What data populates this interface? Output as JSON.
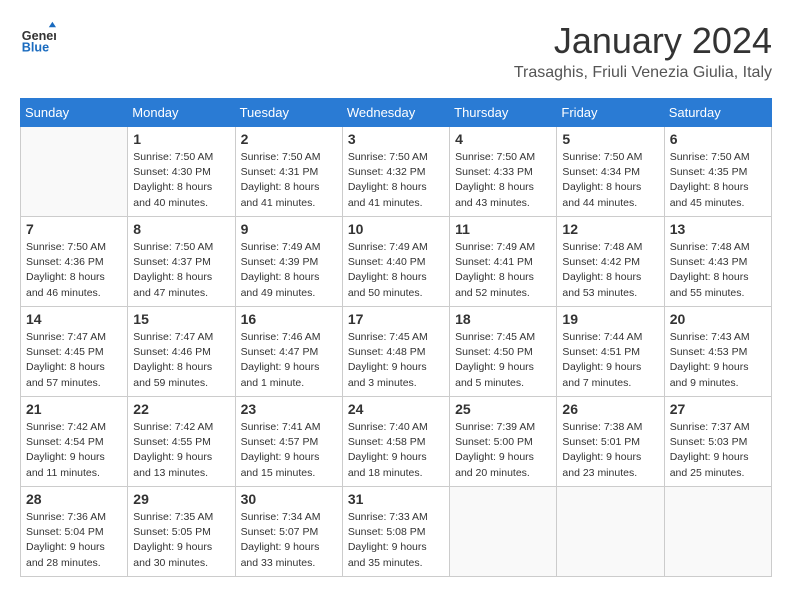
{
  "logo": {
    "line1": "General",
    "line2": "Blue"
  },
  "title": "January 2024",
  "location": "Trasaghis, Friuli Venezia Giulia, Italy",
  "days_of_week": [
    "Sunday",
    "Monday",
    "Tuesday",
    "Wednesday",
    "Thursday",
    "Friday",
    "Saturday"
  ],
  "weeks": [
    [
      {
        "day": "",
        "info": ""
      },
      {
        "day": "1",
        "info": "Sunrise: 7:50 AM\nSunset: 4:30 PM\nDaylight: 8 hours\nand 40 minutes."
      },
      {
        "day": "2",
        "info": "Sunrise: 7:50 AM\nSunset: 4:31 PM\nDaylight: 8 hours\nand 41 minutes."
      },
      {
        "day": "3",
        "info": "Sunrise: 7:50 AM\nSunset: 4:32 PM\nDaylight: 8 hours\nand 41 minutes."
      },
      {
        "day": "4",
        "info": "Sunrise: 7:50 AM\nSunset: 4:33 PM\nDaylight: 8 hours\nand 43 minutes."
      },
      {
        "day": "5",
        "info": "Sunrise: 7:50 AM\nSunset: 4:34 PM\nDaylight: 8 hours\nand 44 minutes."
      },
      {
        "day": "6",
        "info": "Sunrise: 7:50 AM\nSunset: 4:35 PM\nDaylight: 8 hours\nand 45 minutes."
      }
    ],
    [
      {
        "day": "7",
        "info": "Sunrise: 7:50 AM\nSunset: 4:36 PM\nDaylight: 8 hours\nand 46 minutes."
      },
      {
        "day": "8",
        "info": "Sunrise: 7:50 AM\nSunset: 4:37 PM\nDaylight: 8 hours\nand 47 minutes."
      },
      {
        "day": "9",
        "info": "Sunrise: 7:49 AM\nSunset: 4:39 PM\nDaylight: 8 hours\nand 49 minutes."
      },
      {
        "day": "10",
        "info": "Sunrise: 7:49 AM\nSunset: 4:40 PM\nDaylight: 8 hours\nand 50 minutes."
      },
      {
        "day": "11",
        "info": "Sunrise: 7:49 AM\nSunset: 4:41 PM\nDaylight: 8 hours\nand 52 minutes."
      },
      {
        "day": "12",
        "info": "Sunrise: 7:48 AM\nSunset: 4:42 PM\nDaylight: 8 hours\nand 53 minutes."
      },
      {
        "day": "13",
        "info": "Sunrise: 7:48 AM\nSunset: 4:43 PM\nDaylight: 8 hours\nand 55 minutes."
      }
    ],
    [
      {
        "day": "14",
        "info": "Sunrise: 7:47 AM\nSunset: 4:45 PM\nDaylight: 8 hours\nand 57 minutes."
      },
      {
        "day": "15",
        "info": "Sunrise: 7:47 AM\nSunset: 4:46 PM\nDaylight: 8 hours\nand 59 minutes."
      },
      {
        "day": "16",
        "info": "Sunrise: 7:46 AM\nSunset: 4:47 PM\nDaylight: 9 hours\nand 1 minute."
      },
      {
        "day": "17",
        "info": "Sunrise: 7:45 AM\nSunset: 4:48 PM\nDaylight: 9 hours\nand 3 minutes."
      },
      {
        "day": "18",
        "info": "Sunrise: 7:45 AM\nSunset: 4:50 PM\nDaylight: 9 hours\nand 5 minutes."
      },
      {
        "day": "19",
        "info": "Sunrise: 7:44 AM\nSunset: 4:51 PM\nDaylight: 9 hours\nand 7 minutes."
      },
      {
        "day": "20",
        "info": "Sunrise: 7:43 AM\nSunset: 4:53 PM\nDaylight: 9 hours\nand 9 minutes."
      }
    ],
    [
      {
        "day": "21",
        "info": "Sunrise: 7:42 AM\nSunset: 4:54 PM\nDaylight: 9 hours\nand 11 minutes."
      },
      {
        "day": "22",
        "info": "Sunrise: 7:42 AM\nSunset: 4:55 PM\nDaylight: 9 hours\nand 13 minutes."
      },
      {
        "day": "23",
        "info": "Sunrise: 7:41 AM\nSunset: 4:57 PM\nDaylight: 9 hours\nand 15 minutes."
      },
      {
        "day": "24",
        "info": "Sunrise: 7:40 AM\nSunset: 4:58 PM\nDaylight: 9 hours\nand 18 minutes."
      },
      {
        "day": "25",
        "info": "Sunrise: 7:39 AM\nSunset: 5:00 PM\nDaylight: 9 hours\nand 20 minutes."
      },
      {
        "day": "26",
        "info": "Sunrise: 7:38 AM\nSunset: 5:01 PM\nDaylight: 9 hours\nand 23 minutes."
      },
      {
        "day": "27",
        "info": "Sunrise: 7:37 AM\nSunset: 5:03 PM\nDaylight: 9 hours\nand 25 minutes."
      }
    ],
    [
      {
        "day": "28",
        "info": "Sunrise: 7:36 AM\nSunset: 5:04 PM\nDaylight: 9 hours\nand 28 minutes."
      },
      {
        "day": "29",
        "info": "Sunrise: 7:35 AM\nSunset: 5:05 PM\nDaylight: 9 hours\nand 30 minutes."
      },
      {
        "day": "30",
        "info": "Sunrise: 7:34 AM\nSunset: 5:07 PM\nDaylight: 9 hours\nand 33 minutes."
      },
      {
        "day": "31",
        "info": "Sunrise: 7:33 AM\nSunset: 5:08 PM\nDaylight: 9 hours\nand 35 minutes."
      },
      {
        "day": "",
        "info": ""
      },
      {
        "day": "",
        "info": ""
      },
      {
        "day": "",
        "info": ""
      }
    ]
  ]
}
